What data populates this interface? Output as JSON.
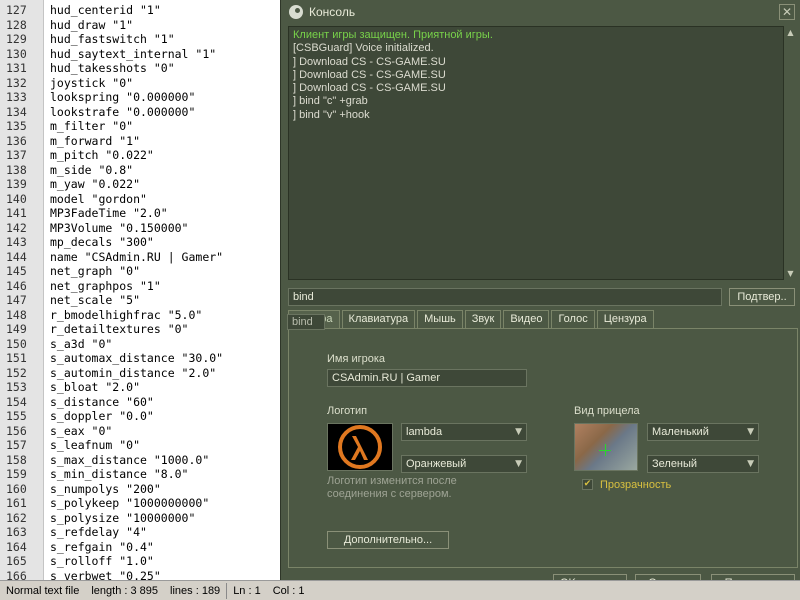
{
  "editor": {
    "lines": [
      {
        "n": "127",
        "t": "hud_centerid \"1\""
      },
      {
        "n": "128",
        "t": "hud_draw \"1\""
      },
      {
        "n": "129",
        "t": "hud_fastswitch \"1\""
      },
      {
        "n": "130",
        "t": "hud_saytext_internal \"1\""
      },
      {
        "n": "131",
        "t": "hud_takesshots \"0\""
      },
      {
        "n": "132",
        "t": "joystick \"0\""
      },
      {
        "n": "133",
        "t": "lookspring \"0.000000\""
      },
      {
        "n": "134",
        "t": "lookstrafe \"0.000000\""
      },
      {
        "n": "135",
        "t": "m_filter \"0\""
      },
      {
        "n": "136",
        "t": "m_forward \"1\""
      },
      {
        "n": "137",
        "t": "m_pitch \"0.022\""
      },
      {
        "n": "138",
        "t": "m_side \"0.8\""
      },
      {
        "n": "139",
        "t": "m_yaw \"0.022\""
      },
      {
        "n": "140",
        "t": "model \"gordon\""
      },
      {
        "n": "141",
        "t": "MP3FadeTime \"2.0\""
      },
      {
        "n": "142",
        "t": "MP3Volume \"0.150000\""
      },
      {
        "n": "143",
        "t": "mp_decals \"300\""
      },
      {
        "n": "144",
        "t": "name \"CSAdmin.RU | Gamer\""
      },
      {
        "n": "145",
        "t": "net_graph \"0\""
      },
      {
        "n": "146",
        "t": "net_graphpos \"1\""
      },
      {
        "n": "147",
        "t": "net_scale \"5\""
      },
      {
        "n": "148",
        "t": "r_bmodelhighfrac \"5.0\""
      },
      {
        "n": "149",
        "t": "r_detailtextures \"0\""
      },
      {
        "n": "150",
        "t": "s_a3d \"0\""
      },
      {
        "n": "151",
        "t": "s_automax_distance \"30.0\""
      },
      {
        "n": "152",
        "t": "s_automin_distance \"2.0\""
      },
      {
        "n": "153",
        "t": "s_bloat \"2.0\""
      },
      {
        "n": "154",
        "t": "s_distance \"60\""
      },
      {
        "n": "155",
        "t": "s_doppler \"0.0\""
      },
      {
        "n": "156",
        "t": "s_eax \"0\""
      },
      {
        "n": "157",
        "t": "s_leafnum \"0\""
      },
      {
        "n": "158",
        "t": "s_max_distance \"1000.0\""
      },
      {
        "n": "159",
        "t": "s_min_distance \"8.0\""
      },
      {
        "n": "160",
        "t": "s_numpolys \"200\""
      },
      {
        "n": "161",
        "t": "s_polykeep \"1000000000\""
      },
      {
        "n": "162",
        "t": "s_polysize \"10000000\""
      },
      {
        "n": "163",
        "t": "s_refdelay \"4\""
      },
      {
        "n": "164",
        "t": "s_refgain \"0.4\""
      },
      {
        "n": "165",
        "t": "s_rolloff \"1.0\""
      },
      {
        "n": "166",
        "t": "s_verbwet \"0.25\""
      }
    ]
  },
  "status": {
    "file_type": "Normal text file",
    "length": "length : 3 895",
    "lines": "lines : 189",
    "ln": "Ln : 1",
    "col": "Col : 1"
  },
  "console": {
    "title": "Консоль",
    "close": "✕",
    "log": [
      {
        "text": "Клиент игры защищен. Приятной игры.",
        "green": true
      },
      {
        "text": "[CSBGuard] Voice initialized.",
        "green": false
      },
      {
        "text": "] Download CS - CS-GAME.SU",
        "green": false
      },
      {
        "text": "] Download CS - CS-GAME.SU",
        "green": false
      },
      {
        "text": "] Download CS - CS-GAME.SU",
        "green": false
      },
      {
        "text": "] bind \"c\" +grab",
        "green": false
      },
      {
        "text": "] bind \"v\" +hook",
        "green": false
      }
    ],
    "input_value": "bind",
    "submit_label": "Подтвер..",
    "autocomplete": "bind"
  },
  "tabs": [
    {
      "label": "ая игра",
      "active": true
    },
    {
      "label": "Клавиатура",
      "active": false
    },
    {
      "label": "Мышь",
      "active": false
    },
    {
      "label": "Звук",
      "active": false
    },
    {
      "label": "Видео",
      "active": false
    },
    {
      "label": "Голос",
      "active": false
    },
    {
      "label": "Цензура",
      "active": false
    }
  ],
  "panel": {
    "player_name_label": "Имя игрока",
    "player_name_value": "CSAdmin.RU | Gamer",
    "logo_label": "Логотип",
    "logo_select": "lambda",
    "logo_color_select": "Оранжевый",
    "logo_hint": "Логотип изменится после соединения с сервером.",
    "crosshair_label": "Вид прицела",
    "crosshair_size_select": "Маленький",
    "crosshair_color_select": "Зеленый",
    "transparency_label": "Прозрачность",
    "transparency_checked": true,
    "advanced_button": "Дополнительно..."
  },
  "footer": {
    "ok": "OK",
    "cancel": "Отмена",
    "apply": "Применить"
  },
  "colors": {
    "console_bg": "#4c5844",
    "log_green": "#78d24a",
    "checkbox_accent": "#d8c040",
    "logo_orange": "#e07820"
  }
}
